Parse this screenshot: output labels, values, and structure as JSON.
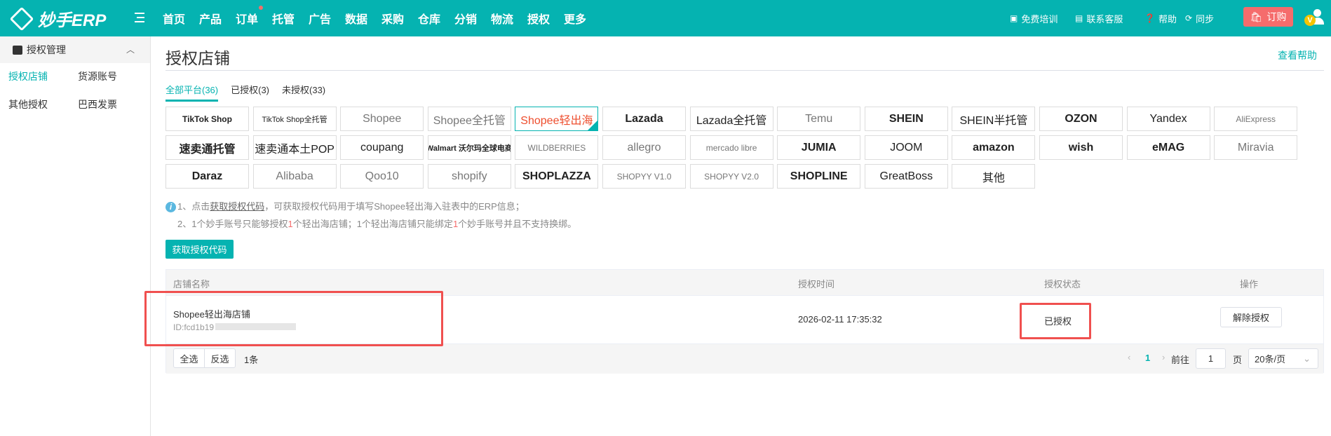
{
  "header": {
    "logo": "妙手ERP",
    "nav": [
      "首页",
      "产品",
      "订单",
      "托管",
      "广告",
      "数据",
      "采购",
      "仓库",
      "分销",
      "物流",
      "授权",
      "更多"
    ],
    "right": {
      "training": "免费培训",
      "service": "联系客服",
      "help": "帮助",
      "sync": "同步",
      "buy": "订购",
      "avatar_badge": "V"
    },
    "accent": "#05b3b1"
  },
  "sidebar": {
    "group": "授权管理",
    "items": [
      "授权店铺",
      "货源账号",
      "其他授权",
      "巴西发票"
    ]
  },
  "main": {
    "title": "授权店铺",
    "help_link": "查看帮助",
    "tabs": [
      "全部平台(36)",
      "已授权(3)",
      "未授权(33)"
    ],
    "platforms": [
      "TikTok Shop",
      "TikTok Shop全托管",
      "Shopee",
      "Shopee全托管",
      "Shopee轻出海",
      "Lazada",
      "Lazada全托管",
      "Temu",
      "SHEIN",
      "SHEIN半托管",
      "OZON",
      "Yandex",
      "AliExpress",
      "速卖通托管",
      "速卖通本土POP",
      "coupang",
      "Walmart 沃尔玛全球电商",
      "WILDBERRIES",
      "allegro",
      "mercado libre",
      "JUMIA",
      "JOOM",
      "amazon",
      "wish",
      "eMAG",
      "Miravia",
      "Daraz",
      "Alibaba",
      "Qoo10",
      "shopify",
      "SHOPLAZZA",
      "SHOPYY V1.0",
      "SHOPYY V2.0",
      "SHOPLINE",
      "GreatBoss",
      "其他"
    ],
    "selected_platform": "Shopee轻出海",
    "tips": {
      "t1_pre": "1、点击",
      "t1_link": "获取授权代码",
      "t1_post": "，可获取授权代码用于填写Shopee轻出海入驻表中的ERP信息；",
      "t2_a": "2、1个妙手账号只能够授权",
      "t2_n1": "1",
      "t2_b": "个轻出海店铺；1个轻出海店铺只能绑定",
      "t2_n2": "1",
      "t2_c": "个妙手账号并且不支持换绑。"
    },
    "get_code_button": "获取授权代码",
    "table": {
      "headers": [
        "店铺名称",
        "授权时间",
        "授权状态",
        "操作"
      ],
      "rows": [
        {
          "name": "Shopee轻出海店铺",
          "id": "ID:fcd1b19",
          "time": "2026-02-11 17:35:32",
          "status": "已授权",
          "action": "解除授权"
        }
      ]
    },
    "footer": {
      "select_all": "全选",
      "invert": "反选",
      "count": "1条",
      "page": "1",
      "goto": "前往",
      "goto_value": "1",
      "page_unit": "页",
      "page_size": "20条/页"
    }
  }
}
